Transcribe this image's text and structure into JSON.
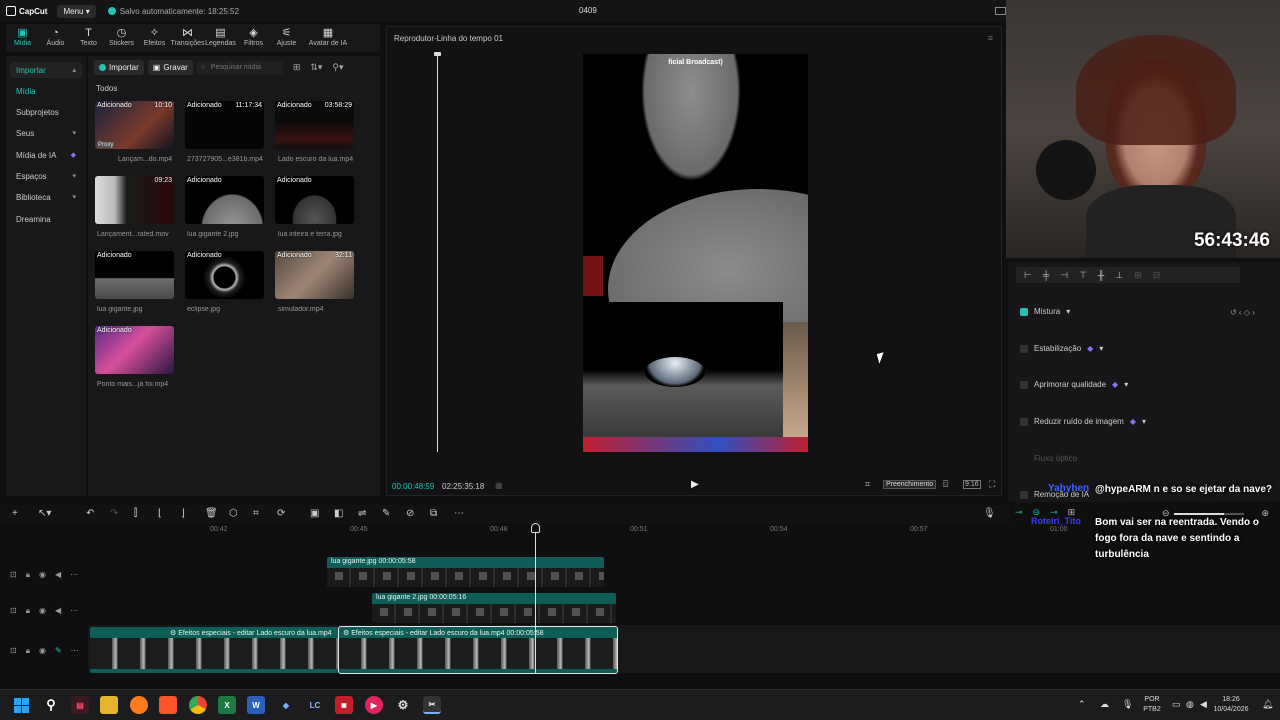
{
  "titlebar": {
    "app_name": "CapCut",
    "menu_label": "Menu",
    "autosave_text": "Salvo automaticamente: 18:25:52",
    "project_title": "0409"
  },
  "toolbar": {
    "items": [
      {
        "label": "Mídia",
        "icon": "media-icon"
      },
      {
        "label": "Áudio",
        "icon": "audio-icon"
      },
      {
        "label": "Texto",
        "icon": "text-icon"
      },
      {
        "label": "Stickers",
        "icon": "sticker-icon"
      },
      {
        "label": "Efeitos",
        "icon": "effects-icon"
      },
      {
        "label": "Transições",
        "icon": "transitions-icon"
      },
      {
        "label": "Legendas",
        "icon": "captions-icon"
      },
      {
        "label": "Filtros",
        "icon": "filters-icon"
      },
      {
        "label": "Ajuste",
        "icon": "adjust-icon"
      },
      {
        "label": "Avatar de IA",
        "icon": "avatar-icon"
      }
    ]
  },
  "sidebar": {
    "items": [
      {
        "label": "Importar"
      },
      {
        "label": "Mídia"
      },
      {
        "label": "Subprojetos"
      },
      {
        "label": "Seus"
      },
      {
        "label": "Mídia de IA"
      },
      {
        "label": "Espaços"
      },
      {
        "label": "Biblioteca"
      },
      {
        "label": "Dreamina"
      }
    ]
  },
  "media": {
    "import_label": "Importar",
    "record_label": "Gravar",
    "search_placeholder": "Pesquisar mídia",
    "section_label": "Todos",
    "items": [
      {
        "tag": "Adicionado",
        "duration": "10:10",
        "name": "Lançam...do.mp4",
        "badge": "Proxy"
      },
      {
        "tag": "Adicionado",
        "duration": "11:17:34",
        "name": "273727905...e381b.mp4"
      },
      {
        "tag": "Adicionado",
        "duration": "03:58:29",
        "name": "Lado escuro da lua.mp4"
      },
      {
        "tag": "",
        "duration": "09:23",
        "name": "Lançament...rated.mov"
      },
      {
        "tag": "Adicionado",
        "duration": "",
        "name": "lua gigante 2.jpg"
      },
      {
        "tag": "Adicionado",
        "duration": "",
        "name": "lua inteira e terra.jpg"
      },
      {
        "tag": "Adicionado",
        "duration": "",
        "name": "lua gigante.jpg"
      },
      {
        "tag": "Adicionado",
        "duration": "",
        "name": "eclipse.jpg"
      },
      {
        "tag": "Adicionado",
        "duration": "32:11",
        "name": "simulador.mp4"
      },
      {
        "tag": "Adicionado",
        "duration": "",
        "name": "Ponto mais...já foi.mp4"
      }
    ]
  },
  "player": {
    "title": "Reprodutor-Linha do tempo 01",
    "overlay_text": "ficial Broadcast)",
    "current_time": "00:00:48:59",
    "total_time": "02:25:35:18",
    "ratio_label": "Preenchimento",
    "aspect_label": "9:16"
  },
  "right_panel": {
    "properties": [
      {
        "label": "Mistura",
        "checked": true,
        "pro": false
      },
      {
        "label": "Estabilização",
        "checked": false,
        "pro": true
      },
      {
        "label": "Aprimorar qualidade",
        "checked": false,
        "pro": true
      },
      {
        "label": "Reduzir ruído de imagem",
        "checked": false,
        "pro": true
      },
      {
        "label": "Fluxo óptico",
        "checked": false,
        "pro": false
      },
      {
        "label": "Remoção de IA",
        "checked": false,
        "pro": false
      }
    ]
  },
  "webcam": {
    "timer": "56:43:46"
  },
  "timeline": {
    "ruler_ticks": [
      "00:42",
      "00:45",
      "00:48",
      "00:51",
      "00:54",
      "00:57",
      "01:00"
    ],
    "clips": {
      "overlay1": {
        "name": "lua gigante.jpg",
        "duration": "00:00:05:58"
      },
      "overlay2": {
        "name": "lua gigante 2.jpg",
        "duration": "00:00:05:16"
      },
      "main1": {
        "effect": "Efeitos especiais - editar",
        "name": "Lado escuro da lua.mp4"
      },
      "main2": {
        "effect": "Efeitos especiais - editar",
        "name": "Lado escuro da lua.mp4",
        "duration": "00:00:05:58"
      }
    }
  },
  "chat": {
    "user1": "Yahyhen",
    "msg1": "@hypeARM n e so se ejetar da nave?",
    "user2": "Roteiri_Tito",
    "msg2": "Bom vai ser na reentrada. Vendo o fogo fora da nave e sentindo a turbulência"
  },
  "taskbar": {
    "lang_line1": "POR",
    "lang_line2": "PTB2",
    "clock_time": "18:26",
    "clock_date": "10/04/2026"
  },
  "colors": {
    "accent": "#22c3b5",
    "clip": "#0e5d57",
    "pro": "#8b6cf6"
  }
}
